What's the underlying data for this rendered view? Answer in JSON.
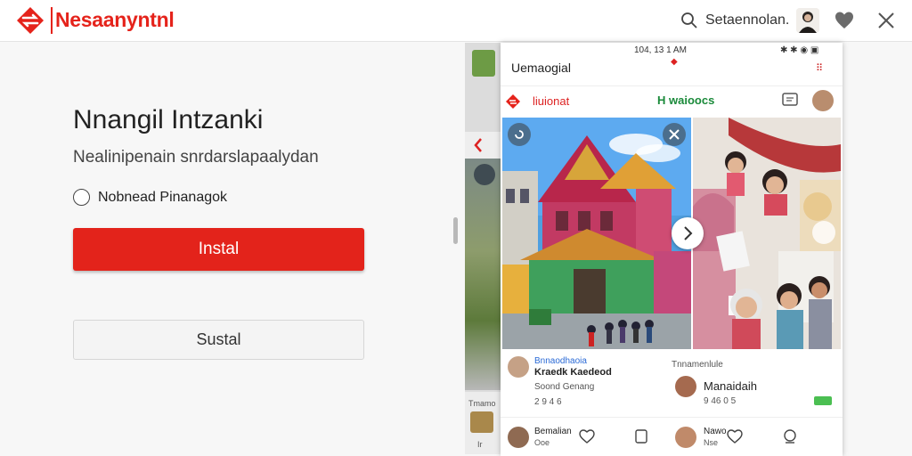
{
  "header": {
    "brand": "Nesaanyntnl",
    "search_text": "Setaennolan.",
    "colors": {
      "brand_red": "#e5231b",
      "text": "#222222"
    }
  },
  "main": {
    "title": "Nnangil Intzanki",
    "subtitle": "Nealinipenain snrdarslapaalydan",
    "radio_label": "Nobnead Pinanagok",
    "primary_button": "Instal",
    "secondary_button": "Sustal"
  },
  "phone": {
    "status_time": "104, 13 1 AM",
    "status_right": "✱ ✱ ◉ ▣",
    "app_title": "Uemaogial",
    "header_brand": "liuionat",
    "header_mid": "H waioocs",
    "posts": [
      {
        "handle": "Bnnaodhaoia",
        "name": "Kraedk Kaedeod",
        "meta": "Soond Genang",
        "count": "2 9 4 6"
      },
      {
        "handle": "Tnnamenlule",
        "name": "Manaidaih",
        "meta": "9 46 0 5"
      }
    ],
    "bottom": [
      {
        "name": "Bemalian",
        "sub": "Ooe"
      },
      {
        "name": "Nawo",
        "sub": "Nse"
      }
    ]
  },
  "back_panel": {
    "label_1": "Tmamo",
    "label_2": "Ir"
  },
  "icons": [
    "logo-icon",
    "search-icon",
    "user-avatar",
    "heart-icon",
    "close-icon",
    "back-chevron-icon",
    "chat-icon",
    "next-arrow-icon"
  ]
}
